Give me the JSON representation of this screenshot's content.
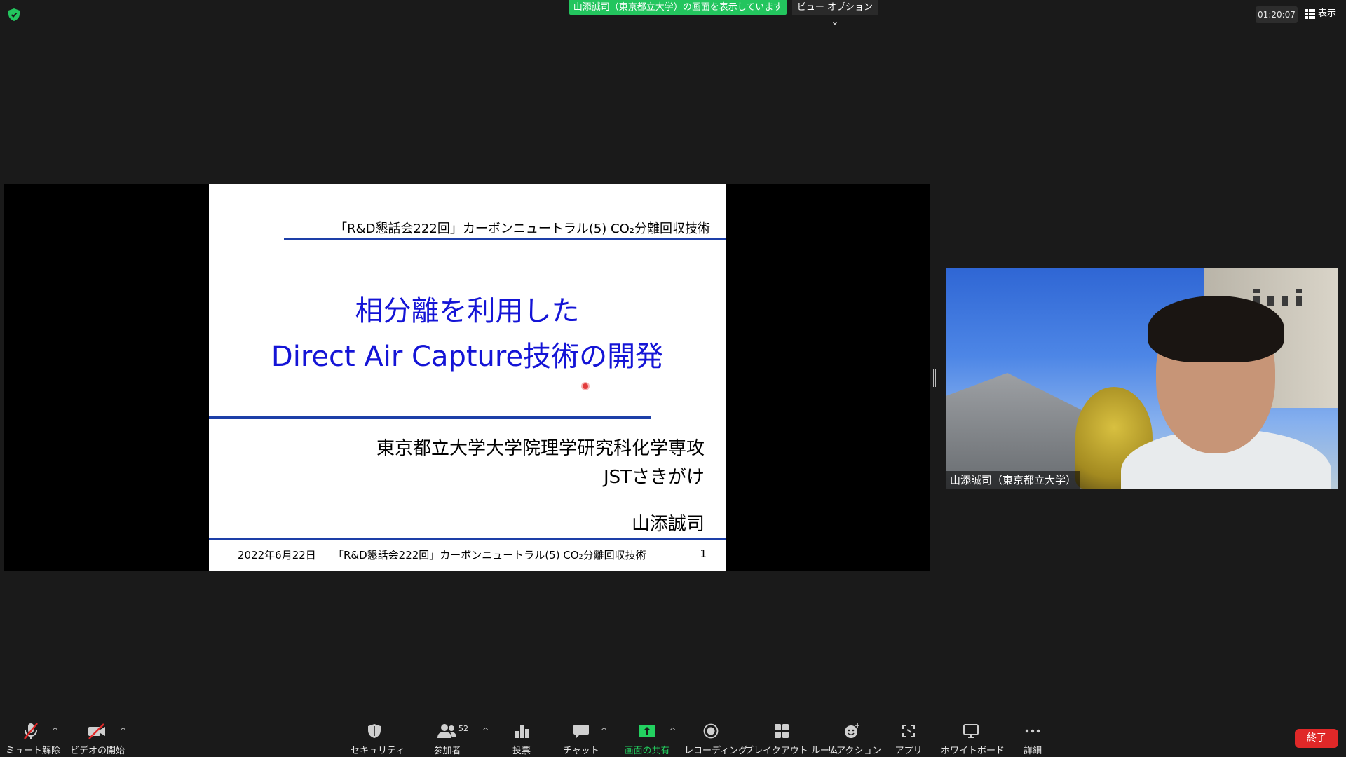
{
  "top_bar": {
    "share_banner": "山添誠司（東京都立大学）の画面を表示しています",
    "view_options": "ビュー オプション ⌄",
    "timer": "01:20:07",
    "display_label": "表示"
  },
  "slide": {
    "header": "「R&D懇話会222回」カーボンニュートラル(5) CO₂分離回収技術",
    "title_line1": "相分離を利用した",
    "title_line2": "Direct Air Capture技術の開発",
    "affiliation1": "東京都立大学大学院理学研究科化学専攻",
    "affiliation2": "JSTさきがけ",
    "presenter": "山添誠司",
    "footer_date": "2022年6月22日",
    "footer_title": "「R&D懇話会222回」カーボンニュートラル(5) CO₂分離回収技術",
    "footer_page": "1"
  },
  "video": {
    "participant_name": "山添誠司（東京都立大学）"
  },
  "toolbar": {
    "mute": "ミュート解除",
    "video": "ビデオの開始",
    "security": "セキュリティ",
    "participants": "参加者",
    "participants_count": "52",
    "polls": "投票",
    "chat": "チャット",
    "share": "画面の共有",
    "record": "レコーディング",
    "breakout": "ブレイクアウト ルーム",
    "reactions": "リアクション",
    "apps": "アプリ",
    "whiteboard": "ホワイトボード",
    "more": "詳細",
    "end": "終了"
  },
  "colors": {
    "accent_green": "#23c55e",
    "end_red": "#e02828",
    "slide_blue": "#1414d6"
  }
}
